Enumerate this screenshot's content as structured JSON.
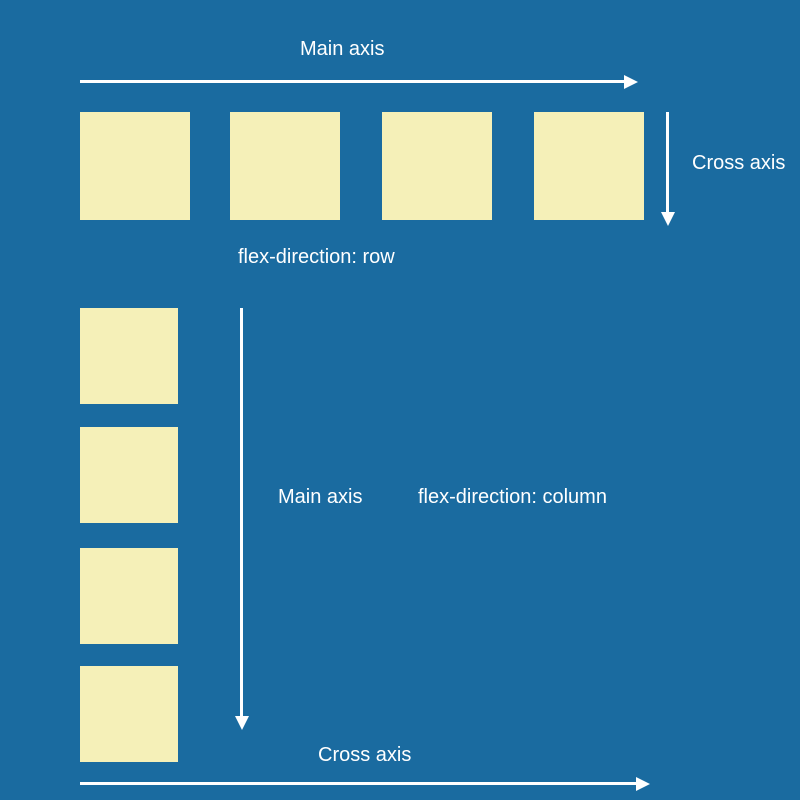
{
  "row_section": {
    "main_axis_label": "Main axis",
    "cross_axis_label": "Cross axis",
    "caption": "flex-direction: row",
    "item_count": 4
  },
  "column_section": {
    "main_axis_label": "Main axis",
    "cross_axis_label": "Cross axis",
    "caption": "flex-direction: column",
    "item_count": 4
  },
  "colors": {
    "background": "#1a6ba0",
    "box_fill": "#f5f0b8",
    "arrow": "#ffffff",
    "text": "#ffffff"
  }
}
